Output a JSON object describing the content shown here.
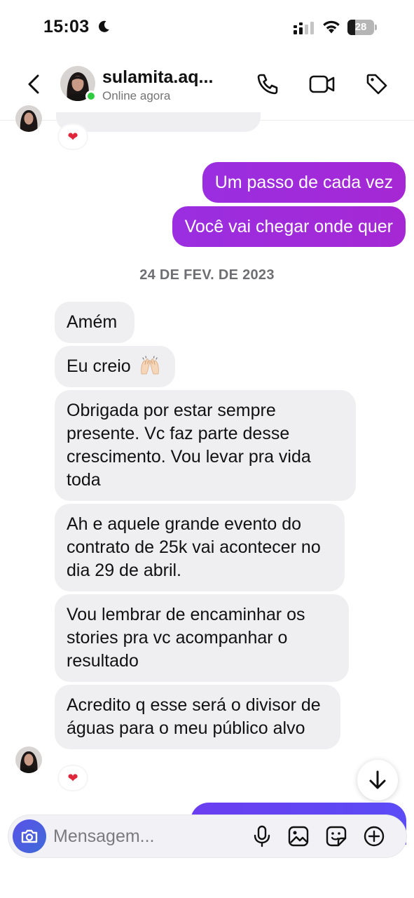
{
  "status_bar": {
    "time": "15:03",
    "battery": "28",
    "battery_percent": 28
  },
  "header": {
    "name": "sulamita.aq...",
    "status": "Online agora"
  },
  "reaction": "❤",
  "sent": [
    {
      "text": "Um passo de cada vez"
    },
    {
      "text": "Você vai chegar onde quer"
    }
  ],
  "date_divider": "24 DE FEV. DE 2023",
  "received": [
    {
      "text": "Amém"
    },
    {
      "text": "Eu creio"
    },
    {
      "text": "Obrigada por estar sempre presente. Vc faz parte desse crescimento. Vou levar pra vida toda"
    },
    {
      "text": "Ah e aquele grande evento do contrato de 25k vai acontecer no dia 29 de abril."
    },
    {
      "text": "Vou lembrar de encaminhar os stories pra vc acompanhar o resultado"
    },
    {
      "text": "Acredito q esse será o divisor de águas para o meu público alvo"
    }
  ],
  "composer": {
    "placeholder": "Mensagem..."
  },
  "colors": {
    "sent_bubble": "#a527d9",
    "received_bubble": "#efeff1",
    "online": "#2ecc40",
    "camera": "#4c5bd4"
  }
}
